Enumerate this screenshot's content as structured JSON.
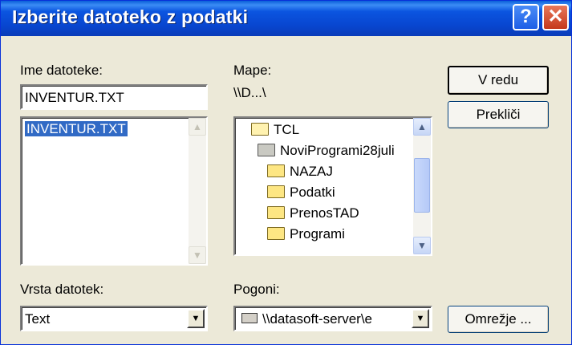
{
  "dialog": {
    "title": "Izberite datoteko z podatki",
    "help_glyph": "?",
    "close_glyph": "✕"
  },
  "file_section": {
    "label": "Ime datoteke:",
    "filename_value": "INVENTUR.TXT",
    "files": [
      "INVENTUR.TXT"
    ]
  },
  "folder_section": {
    "label": "Mape:",
    "current_path": "\\\\D...\\",
    "folders": [
      {
        "name": "TCL",
        "icon": "open-folder-icon"
      },
      {
        "name": "NoviProgrami28juli",
        "icon": "open-folder-icon"
      },
      {
        "name": "NAZAJ",
        "icon": "folder-icon"
      },
      {
        "name": "Podatki",
        "icon": "folder-icon"
      },
      {
        "name": "PrenosTAD",
        "icon": "folder-icon"
      },
      {
        "name": "Programi",
        "icon": "folder-icon"
      }
    ]
  },
  "file_type": {
    "label": "Vrsta datotek:",
    "selected": "Text"
  },
  "drives": {
    "label": "Pogoni:",
    "selected": "\\\\datasoft-server\\e",
    "icon": "network-drive-icon"
  },
  "buttons": {
    "ok": "V redu",
    "cancel": "Prekliči",
    "network": "Omrežje ..."
  },
  "colors": {
    "titlebar": "#0846d0",
    "selection": "#316ac5",
    "face": "#ece9d8"
  }
}
